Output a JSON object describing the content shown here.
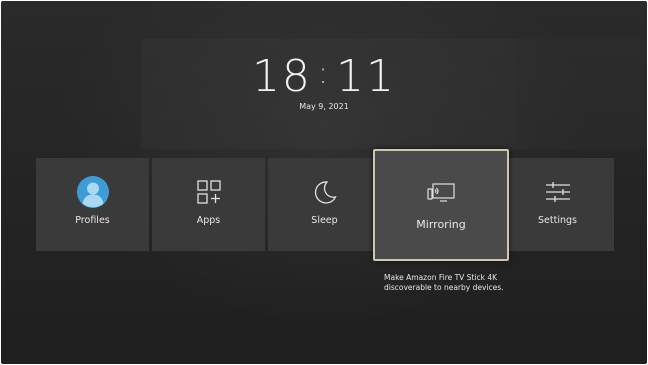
{
  "home": {
    "clock": {
      "hours": "18",
      "minutes": "11"
    },
    "date": "May 9, 2021"
  },
  "tiles": [
    {
      "label": "Profiles",
      "icon": "profile-avatar-icon"
    },
    {
      "label": "Apps",
      "icon": "apps-grid-icon"
    },
    {
      "label": "Sleep",
      "icon": "moon-icon"
    },
    {
      "label": "Mirroring",
      "icon": "screen-mirroring-icon"
    },
    {
      "label": "Settings",
      "icon": "sliders-icon"
    }
  ],
  "focused": {
    "tile": "Mirroring",
    "description": "Make Amazon Fire TV Stick 4K discoverable to nearby devices."
  },
  "colors": {
    "background": "#242424",
    "tile": "#3a3a3a",
    "focused_tile": "#4a4a4a",
    "focus_border": "#cfc6b0",
    "avatar": "#3d9bd6"
  }
}
